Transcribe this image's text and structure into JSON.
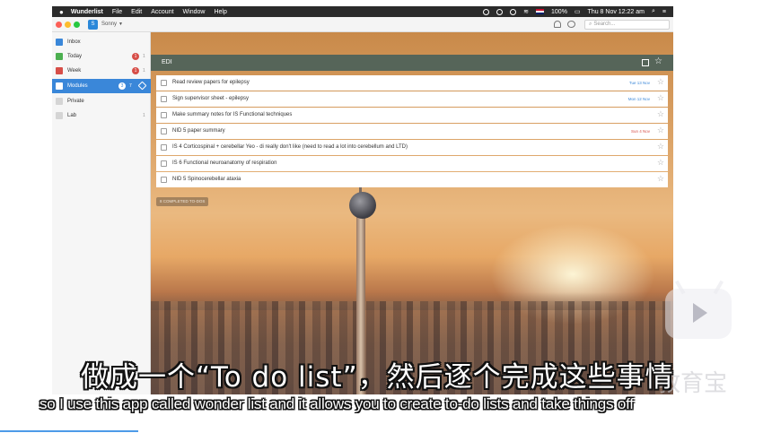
{
  "menubar": {
    "apple": "",
    "items": [
      "Wunderlist",
      "File",
      "Edit",
      "Account",
      "Window",
      "Help"
    ],
    "battery": "100%",
    "datetime": "Thu 8 Nov  12:22 am"
  },
  "titlebar": {
    "avatar_letter": "S",
    "user_name": "Sonny",
    "search_placeholder": "Search..."
  },
  "sidebar": {
    "items": [
      {
        "label": "Inbox",
        "badge": "",
        "count": "",
        "icon_color": "#3a87d9"
      },
      {
        "label": "Today",
        "badge": "1",
        "count": "1",
        "icon_color": "#4caf50"
      },
      {
        "label": "Week",
        "badge": "1",
        "count": "1",
        "icon_color": "#d74e48"
      },
      {
        "label": "Modules",
        "badge": "3",
        "count": "7",
        "icon_color": "#ffffff"
      },
      {
        "label": "Private",
        "badge": "",
        "count": "",
        "icon_color": "#bbbbbb"
      },
      {
        "label": "Lab",
        "badge": "",
        "count": "1",
        "icon_color": "#bbbbbb"
      }
    ]
  },
  "list": {
    "title": "EDI",
    "completed_label": "8 COMPLETED TO-DOS",
    "todos": [
      {
        "text": "Read review papers for epilepsy",
        "due": "Tue 13 Nov",
        "overdue": false
      },
      {
        "text": "Sign supervisor sheet - epilepsy",
        "due": "Mon 12 Nov",
        "overdue": false
      },
      {
        "text": "Make summary notes for IS Functional techniques",
        "due": "",
        "overdue": false
      },
      {
        "text": "NID 5 paper summary",
        "due": "Sun 4 Nov",
        "overdue": true
      },
      {
        "text": "IS 4 Corticospinal + cerebellar Yeo - di really don't like (need to read a lot into cerebellum and LTD)",
        "due": "",
        "overdue": false
      },
      {
        "text": "IS 6 Functional neuroanatomy of respiration",
        "due": "",
        "overdue": false
      },
      {
        "text": "NID 5 Spinocerebellar ataxia",
        "due": "",
        "overdue": false
      }
    ]
  },
  "subtitles": {
    "chinese": "做成一个“To do list”，然后逐个完成这些事情",
    "english": "so I use this app called wonder list and it allows you to create to-do lists and take things off"
  },
  "watermark": {
    "text": "教育宝"
  }
}
